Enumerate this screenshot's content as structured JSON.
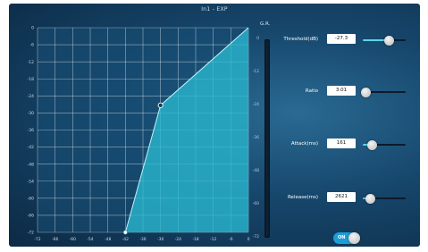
{
  "window": {
    "title": "In1 - EXP"
  },
  "graph": {
    "x_ticks": [
      "-72",
      "-66",
      "-60",
      "-54",
      "-48",
      "-42",
      "-36",
      "-30",
      "-24",
      "-18",
      "-12",
      "-6",
      "0"
    ],
    "y_ticks": [
      "0",
      "-6",
      "-12",
      "-18",
      "-24",
      "-30",
      "-36",
      "-42",
      "-48",
      "-54",
      "-60",
      "-66",
      "-72"
    ],
    "curve_points": [
      [
        -42,
        -72
      ],
      [
        -30,
        -27.3
      ],
      [
        0,
        0
      ]
    ],
    "control_point": [
      -30,
      -27.3
    ],
    "fill_color": "#2ab8cf",
    "grid_color": "#ffffff"
  },
  "gr_meter": {
    "label": "G.R.",
    "ticks": [
      "0",
      "-12",
      "-24",
      "-36",
      "-48",
      "-60",
      "-72"
    ]
  },
  "controls": [
    {
      "label": "Threshold(dB)",
      "value": "-27.3",
      "level": 0.62
    },
    {
      "label": "Ratio",
      "value": "3.01",
      "level": 0.08
    },
    {
      "label": "Attack(ms)",
      "value": "161",
      "level": 0.22
    },
    {
      "label": "Release(ms)",
      "value": "2621",
      "level": 0.18
    }
  ],
  "toggle": {
    "label": "ON",
    "state": true
  },
  "accent_color": "#5ad6ea"
}
